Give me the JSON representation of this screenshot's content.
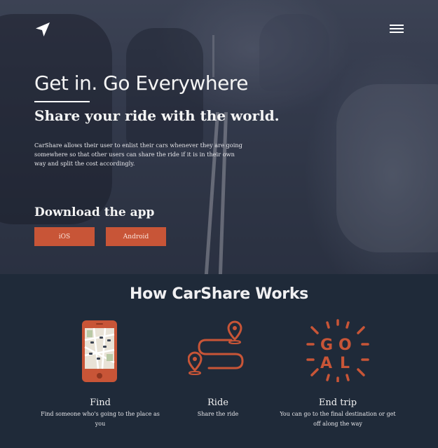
{
  "colors": {
    "accent": "#c85537",
    "dark_bg": "#1f2a39"
  },
  "header": {
    "logo_icon": "navigation-arrow-icon",
    "menu_icon": "hamburger-menu-icon"
  },
  "hero": {
    "title": "Get in. Go Everywhere",
    "subtitle": "Share your ride with the world.",
    "description": "CarShare allows their user to enlist their cars whenever they are going somewhere so that other users can share the ride if it is in their own way and split the cost accordingly."
  },
  "download": {
    "heading": "Download the app",
    "ios_label": "iOS",
    "android_label": "Android"
  },
  "how": {
    "title": "How CarShare Works",
    "features": [
      {
        "icon": "phone-map-icon",
        "title": "Find",
        "description": "Find someone who's going to the place as you"
      },
      {
        "icon": "route-pins-icon",
        "title": "Ride",
        "description": "Share the ride"
      },
      {
        "icon": "goal-icon",
        "title": "End trip",
        "description": "You can go to the final destination or get off along the way"
      }
    ]
  }
}
